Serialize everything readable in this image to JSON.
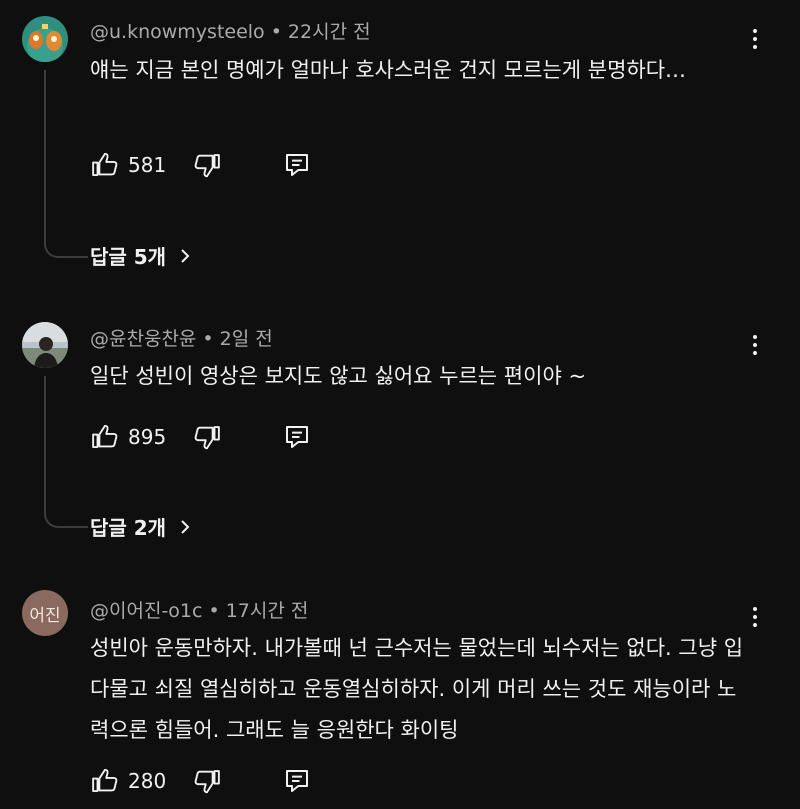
{
  "comments": [
    {
      "author": "@u.knowmysteelo",
      "time": "22시간 전",
      "text": "얘는 지금 본인 명예가 얼마나 호사스러운 건지 모르는게 분명하다…",
      "likes": "581",
      "replies_label": "답글 5개"
    },
    {
      "author": "@윤찬웅찬윤",
      "time": "2일 전",
      "text": "일단 성빈이 영상은 보지도 않고 싫어요 누르는 편이야 ~",
      "likes": "895",
      "replies_label": "답글 2개"
    },
    {
      "author": "@이어진-o1c",
      "time": "17시간 전",
      "avatar_text": "어진",
      "text": "성빈아 운동만하자. 내가볼때 넌 근수저는 물었는데 뇌수저는 없다. 그냥 입 다물고 쇠질 열심히하고 운동열심히하자. 이게 머리 쓰는 것도 재능이라 노력으론 힘들어. 그래도 늘 응원한다 화이팅",
      "likes": "280"
    }
  ],
  "colors": {
    "background": "#0f0f0f",
    "text": "#f1f1f1",
    "meta": "#aaaaaa",
    "thread_line": "#3d3d3d",
    "avatar3_bg": "#8a6a5e"
  },
  "icons": [
    "like-icon",
    "dislike-icon",
    "reply-icon",
    "more-vert-icon",
    "chevron-right-icon"
  ]
}
